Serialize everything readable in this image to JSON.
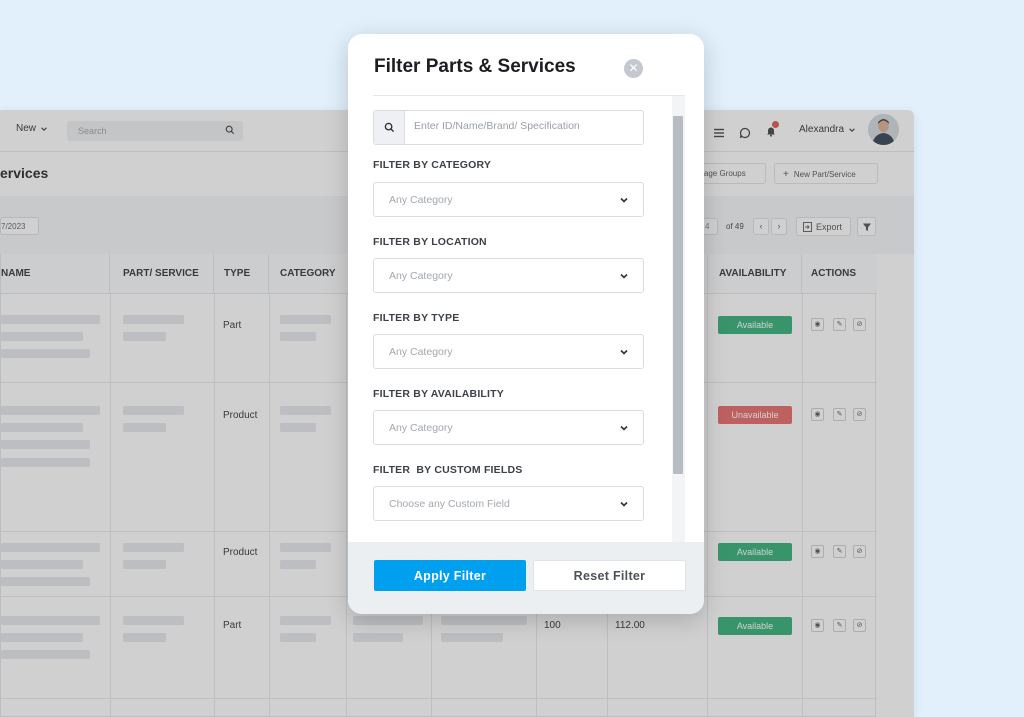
{
  "app": {
    "topbar": {
      "new_label": "New",
      "search_placeholder": "Search",
      "user_name": "Alexandra",
      "notification_count": "1"
    },
    "page_title": "ervices",
    "manage_groups_label": "anage Groups",
    "new_part_service_label": "New Part/Service",
    "date_filter": "7/2023",
    "pagination": {
      "current_page": "4",
      "of_pages": "of 49"
    },
    "export_label": "Export",
    "table": {
      "columns": [
        "NAME",
        "PART/ SERVICE",
        "TYPE",
        "CATEGORY",
        "AVAILABILITY",
        "ACTIONS"
      ],
      "rows": [
        {
          "type": "Part",
          "availability": "Available",
          "qty": "",
          "price": ""
        },
        {
          "type": "Product",
          "availability": "Unavailable",
          "qty": "",
          "price": ""
        },
        {
          "type": "Product",
          "availability": "Available",
          "qty": "",
          "price": ""
        },
        {
          "type": "Part",
          "availability": "Available",
          "qty": "100",
          "price": "112.00"
        }
      ]
    }
  },
  "modal": {
    "title": "Filter Parts & Services",
    "search_placeholder": "Enter ID/Name/Brand/ Specification",
    "filters": [
      {
        "label": "FILTER BY CATEGORY",
        "placeholder": "Any Category"
      },
      {
        "label": "FILTER BY LOCATION",
        "placeholder": "Any Category"
      },
      {
        "label": "FILTER BY TYPE",
        "placeholder": "Any Category"
      },
      {
        "label": "FILTER BY AVAILABILITY",
        "placeholder": "Any Category"
      },
      {
        "label": "FILTER  BY CUSTOM FIELDS",
        "placeholder": "Choose any Custom Field"
      }
    ],
    "apply_label": "Apply Filter",
    "reset_label": "Reset Filter"
  },
  "colors": {
    "accent": "#00a0ef",
    "available": "#1fa86a",
    "unavailable": "#e55a5a",
    "background": "#e1f0fb"
  }
}
